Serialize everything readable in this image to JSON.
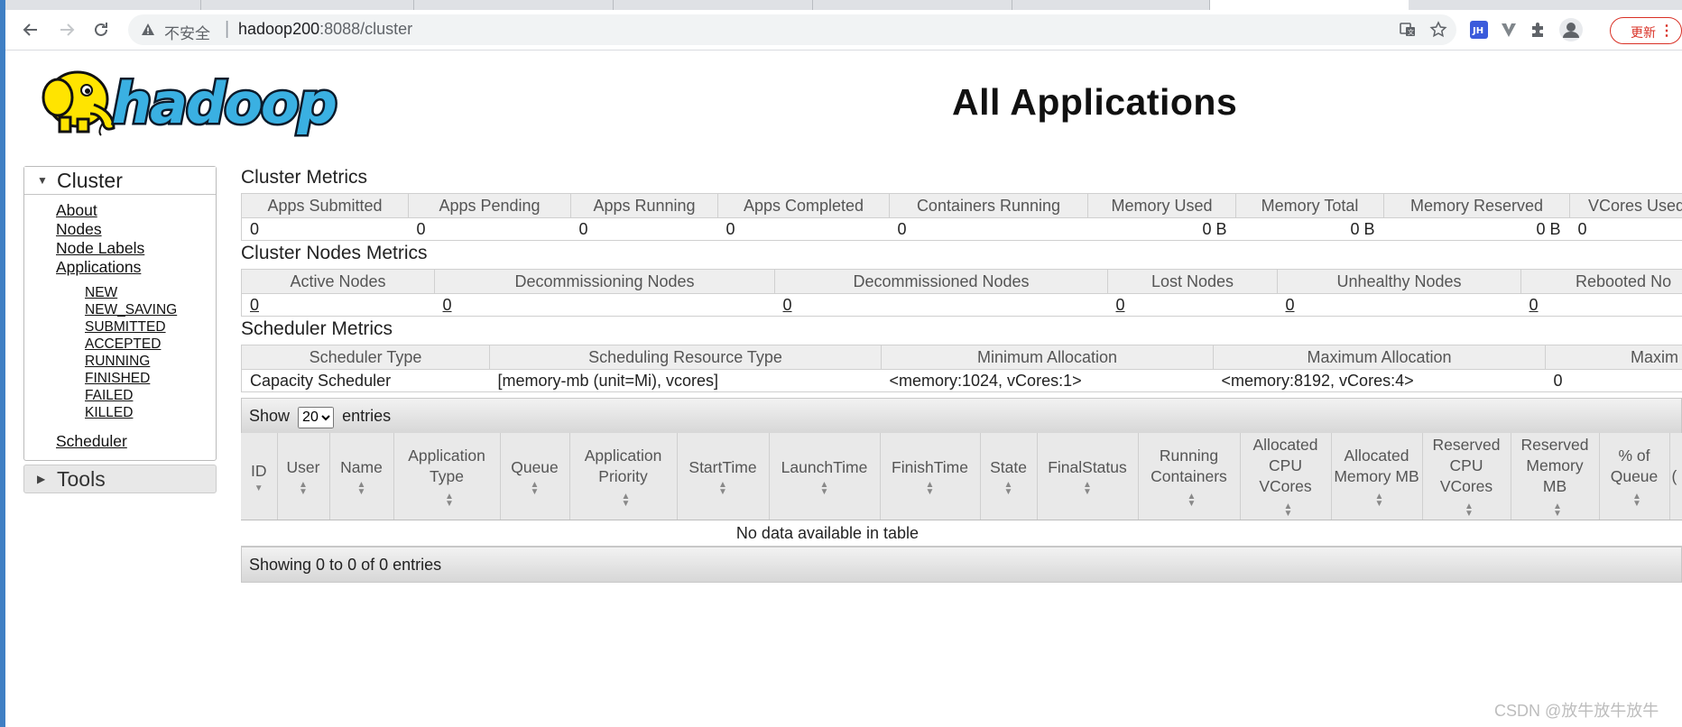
{
  "browser": {
    "security_label": "不安全",
    "url_host": "hadoop200",
    "url_rest": ":8088/cluster",
    "update_label": "更新"
  },
  "page": {
    "title": "All Applications"
  },
  "sidebar": {
    "cluster_label": "Cluster",
    "links": [
      "About",
      "Nodes",
      "Node Labels",
      "Applications"
    ],
    "app_states": [
      "NEW",
      "NEW_SAVING",
      "SUBMITTED",
      "ACCEPTED",
      "RUNNING",
      "FINISHED",
      "FAILED",
      "KILLED"
    ],
    "scheduler_label": "Scheduler",
    "tools_label": "Tools"
  },
  "cluster_metrics": {
    "title": "Cluster Metrics",
    "headers": [
      "Apps Submitted",
      "Apps Pending",
      "Apps Running",
      "Apps Completed",
      "Containers Running",
      "Memory Used",
      "Memory Total",
      "Memory Reserved",
      "VCores Used"
    ],
    "values": [
      "0",
      "0",
      "0",
      "0",
      "0",
      "0 B",
      "0 B",
      "0 B",
      "0"
    ]
  },
  "node_metrics": {
    "title": "Cluster Nodes Metrics",
    "headers": [
      "Active Nodes",
      "Decommissioning Nodes",
      "Decommissioned Nodes",
      "Lost Nodes",
      "Unhealthy Nodes",
      "Rebooted No"
    ],
    "values": [
      "0",
      "0",
      "0",
      "0",
      "0",
      "0"
    ]
  },
  "scheduler_metrics": {
    "title": "Scheduler Metrics",
    "headers": [
      "Scheduler Type",
      "Scheduling Resource Type",
      "Minimum Allocation",
      "Maximum Allocation",
      "Maxim"
    ],
    "values": [
      "Capacity Scheduler",
      "[memory-mb (unit=Mi), vcores]",
      "<memory:1024, vCores:1>",
      "<memory:8192, vCores:4>",
      "0"
    ]
  },
  "apps_table": {
    "show_label": "Show",
    "page_size": "20",
    "entries_label": "entries",
    "columns": [
      "ID",
      "User",
      "Name",
      "Application Type",
      "Queue",
      "Application Priority",
      "StartTime",
      "LaunchTime",
      "FinishTime",
      "State",
      "FinalStatus",
      "Running Containers",
      "Allocated CPU VCores",
      "Allocated Memory MB",
      "Reserved CPU VCores",
      "Reserved Memory MB",
      "% of Queue",
      "("
    ],
    "empty_message": "No data available in table",
    "info": "Showing 0 to 0 of 0 entries"
  },
  "watermark": "CSDN @放牛放牛放牛"
}
